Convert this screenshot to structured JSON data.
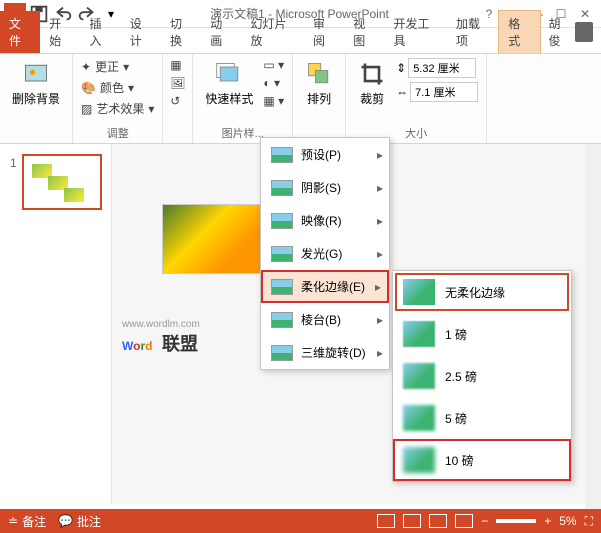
{
  "title": "演示文稿1 - Microsoft PowerPoint",
  "tabs": {
    "file": "文件",
    "list": [
      "开始",
      "插入",
      "设计",
      "切换",
      "动画",
      "幻灯片放",
      "审阅",
      "视图",
      "开发工具",
      "加载项"
    ],
    "format": "格式"
  },
  "user": "胡俊",
  "ribbon": {
    "removeBg": "删除背景",
    "corrections": "更正",
    "color": "颜色",
    "artistic": "艺术效果",
    "adjustLabel": "调整",
    "quickStyles": "快速样式",
    "pictureStylesLabel": "图片样...",
    "arrange": "排列",
    "crop": "裁剪",
    "height": "5.32 厘米",
    "width": "7.1 厘米",
    "sizeLabel": "大小"
  },
  "slideNum": "1",
  "watermark": {
    "url": "www.wordlm.com",
    "text": "联盟"
  },
  "menu1": [
    {
      "label": "预设(P)"
    },
    {
      "label": "阴影(S)"
    },
    {
      "label": "映像(R)"
    },
    {
      "label": "发光(G)"
    },
    {
      "label": "柔化边缘(E)",
      "hl": true
    },
    {
      "label": "棱台(B)"
    },
    {
      "label": "三维旋转(D)"
    }
  ],
  "menu2": [
    {
      "label": "无柔化边缘",
      "sel": true,
      "cls": "sharp"
    },
    {
      "label": "1 磅",
      "cls": "b1"
    },
    {
      "label": "2.5 磅",
      "cls": "b2"
    },
    {
      "label": "5 磅",
      "cls": "b3"
    },
    {
      "label": "10 磅",
      "cls": "b4",
      "hl": true
    }
  ],
  "statusbar": {
    "notes": "备注",
    "comments": "批注",
    "zoom": "5%"
  }
}
